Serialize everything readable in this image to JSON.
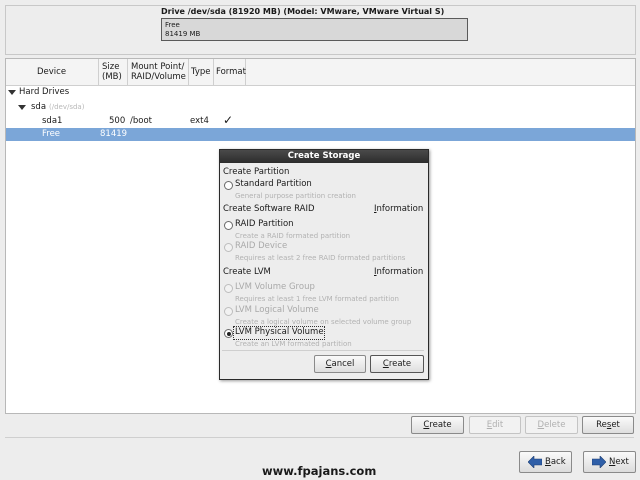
{
  "drive": {
    "title": "Drive /dev/sda (81920 MB) (Model: VMware, VMware Virtual S)",
    "segment_name": "Free",
    "segment_size": "81419 MB"
  },
  "table": {
    "headers": {
      "device": "Device",
      "size_l1": "Size",
      "size_l2": "(MB)",
      "mount_l1": "Mount Point/",
      "mount_l2": "RAID/Volume",
      "type": "Type",
      "format": "Format"
    },
    "group": "Hard Drives",
    "disk_name": "sda",
    "disk_path": "(/dev/sda)",
    "rows": [
      {
        "device": "sda1",
        "size": "500",
        "mount": "/boot",
        "type": "ext4",
        "format": "✓"
      },
      {
        "device": "Free",
        "size": "81419",
        "mount": "",
        "type": "",
        "format": ""
      }
    ]
  },
  "dialog": {
    "title": "Create Storage",
    "partition_section": "Create Partition",
    "standard_partition": "Standard Partition",
    "standard_desc": "General purpose partition creation",
    "raid_section": "Create Software RAID",
    "raid_info": "Information",
    "raid_partition": "RAID Partition",
    "raid_partition_desc": "Create a RAID formated partition",
    "raid_device": "RAID Device",
    "raid_device_desc": "Requires at least 2 free RAID formated partitions",
    "lvm_section": "Create LVM",
    "lvm_info": "Information",
    "lvm_vg": "LVM Volume Group",
    "lvm_vg_desc": "Requires at least 1 free LVM formated partition",
    "lvm_lv": "LVM Logical Volume",
    "lvm_lv_desc": "Create a logical volume on selected volume group",
    "lvm_pv": "LVM Physical Volume",
    "lvm_pv_desc": "Create an LVM formated partition",
    "cancel_mn": "C",
    "cancel_rest": "ancel",
    "create_mn": "C",
    "create_rest": "reate"
  },
  "actions": {
    "create_mn": "C",
    "create_rest": "reate",
    "edit_mn": "E",
    "edit_rest": "dit",
    "delete_mn": "D",
    "delete_rest": "elete",
    "reset_pre": "Re",
    "reset_mn": "s",
    "reset_rest": "et"
  },
  "nav": {
    "back_mn": "B",
    "back_rest": "ack",
    "next_mn": "N",
    "next_rest": "ext"
  },
  "watermark": "www.fpajans.com",
  "colors": {
    "selection": "#7ba6d8",
    "nav_arrow": "#2f5fa8"
  }
}
